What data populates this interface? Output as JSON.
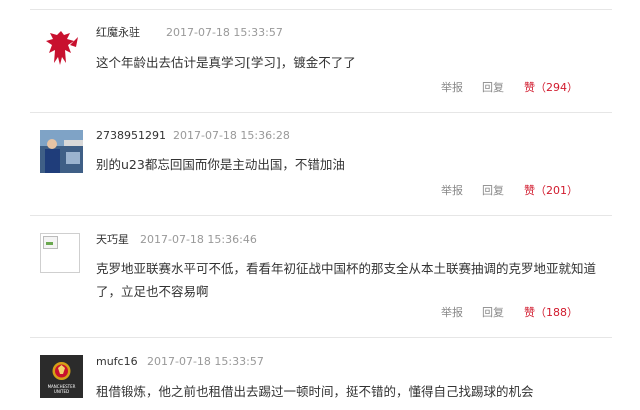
{
  "comments": [
    {
      "user": "红魔永驻",
      "time": "2017-07-18 15:33:57",
      "text": "这个年龄出去估计是真学习[学习]，镀金不了了",
      "avatar": "man-utd-devil-red-logo",
      "actions": {
        "report": "举报",
        "reply": "回复",
        "like": "赞（294）"
      }
    },
    {
      "user": "2738951291",
      "time": "2017-07-18 15:36:28",
      "text": "别的u23都忘回国而你是主动出国，不错加油",
      "avatar": "player-photo",
      "actions": {
        "report": "举报",
        "reply": "回复",
        "like": "赞（201）"
      }
    },
    {
      "user": "天巧星",
      "time": "2017-07-18 15:36:46",
      "text": "克罗地亚联赛水平可不低，看看年初征战中国杯的那支全从本土联赛抽调的克罗地亚就知道了，立足也不容易啊",
      "avatar": "broken-image",
      "actions": {
        "report": "举报",
        "reply": "回复",
        "like": "赞（188）"
      }
    },
    {
      "user": "mufc16",
      "time": "2017-07-18 15:33:57",
      "text": "租借锻炼，他之前也租借出去踢过一顿时间，挺不错的，懂得自己找踢球的机会",
      "avatar": "manchester-united-crest",
      "avatar_text": "MANCHESTER UNITED"
    }
  ]
}
